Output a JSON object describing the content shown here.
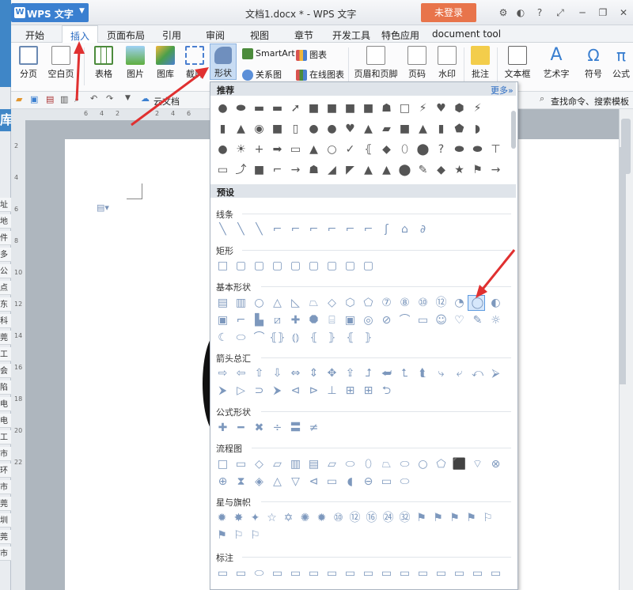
{
  "app": {
    "logo": "WPS 文字",
    "doc_title": "文档1.docx * - WPS 文字",
    "login": "未登录"
  },
  "bg_app": {
    "banner_char": "库",
    "list": [
      "址",
      "地",
      "件",
      "多",
      "公",
      "点",
      "东",
      "科",
      "莞",
      "工",
      "会",
      "陷",
      "电",
      "电",
      "工",
      "市",
      "环",
      "市",
      "莞",
      "圳",
      "莞",
      "市"
    ]
  },
  "menu": [
    "开始",
    "插入",
    "页面布局",
    "引用",
    "审阅",
    "视图",
    "章节",
    "开发工具",
    "特色应用",
    "document tool"
  ],
  "ribbon": {
    "page_break": "分页",
    "blank_page": "空白页",
    "table": "表格",
    "picture": "图片",
    "gallery": "图库",
    "screenshot": "截屏",
    "shape": "形状",
    "smartart": "SmartArt",
    "chart": "图表",
    "relation": "关系图",
    "online_chart": "在线图表",
    "header_footer": "页眉和页脚",
    "page_number": "页码",
    "watermark": "水印",
    "comment": "批注",
    "textbox": "文本框",
    "wordart": "艺术字",
    "symbol": "符号",
    "formula": "公式"
  },
  "quickbar": {
    "cloud": "云文档",
    "search": "查找命令、搜索模板"
  },
  "ruler": [
    "6",
    "4",
    "2",
    "2",
    "4",
    "6"
  ],
  "vruler": [
    "2",
    "4",
    "6",
    "8",
    "10",
    "12",
    "14",
    "16",
    "18",
    "20",
    "22"
  ],
  "panel": {
    "recommend": "推荐",
    "more": "更多",
    "preset": "预设",
    "lines": "线条",
    "rect": "矩形",
    "basic": "基本形状",
    "arrows": "箭头总汇",
    "formula": "公式形状",
    "flowchart": "流程图",
    "stars": "星与旗帜",
    "callout": "标注",
    "rec_rows": [
      [
        "●",
        "⬬",
        "▬",
        "▬",
        "➚",
        "■",
        "■",
        "■",
        "■",
        "☗",
        "□",
        "⚡",
        "♥",
        "⬢",
        "⚡"
      ],
      [
        "▮",
        "▲",
        "◉",
        "■",
        "▯",
        "●",
        "●",
        "♥",
        "▲",
        "▰",
        "■",
        "▲",
        "▮",
        "⬟",
        "◗"
      ],
      [
        "●",
        "☀",
        "+",
        "➡",
        "▭",
        "▲",
        "○",
        "✓",
        "⦃",
        "◆",
        "⬯",
        "⬤",
        "?",
        "⬬",
        "⬬",
        "⊤"
      ],
      [
        "▭",
        "⤴",
        "■",
        "⌐",
        "→",
        "☗",
        "◢",
        "◤",
        "▲",
        "▲",
        "⬤",
        "✎",
        "◆",
        "★",
        "⚑",
        "→"
      ]
    ],
    "line_row": [
      "╲",
      "╲",
      "╲",
      "⌐",
      "⌐",
      "⌐",
      "⌐",
      "⌐",
      "⌐",
      "ʃ",
      "⌂",
      "∂"
    ],
    "rect_row": [
      "□",
      "▢",
      "▢",
      "▢",
      "▢",
      "▢",
      "▢",
      "▢",
      "▢"
    ],
    "basic_rows": [
      [
        "▤",
        "▥",
        "○",
        "△",
        "◺",
        "⏢",
        "◇",
        "⬡",
        "⬠",
        "⑦",
        "⑧",
        "⑩",
        "⑫",
        "◔",
        "◯",
        "◐"
      ],
      [
        "▣",
        "⌐",
        "▙",
        "⧄",
        "✚",
        "⯃",
        "⌸",
        "▣",
        "◎",
        "⊘",
        "⌒",
        "▭",
        "☺",
        "♡",
        "✎",
        "☼"
      ],
      [
        "☾",
        "⬭",
        "⌒",
        "⦃⦄",
        "⦅⦆",
        "⦃",
        "⦄",
        "⦃",
        "⦄"
      ]
    ],
    "arrow_rows": [
      [
        "⇨",
        "⇦",
        "⇧",
        "⇩",
        "⇔",
        "⇕",
        "✥",
        "⇪",
        "⮥",
        "⮨",
        "⮤",
        "⮬",
        "⤷",
        "⤶",
        "⤺",
        "⮚"
      ],
      [
        "⮞",
        "▷",
        "⊃",
        "⮞",
        "⊲",
        "⊳",
        "⊥",
        "⊞",
        "⊞",
        "⮌"
      ]
    ],
    "formula_row": [
      "✚",
      "━",
      "✖",
      "÷",
      "〓",
      "≠"
    ],
    "flow_rows": [
      [
        "□",
        "▭",
        "◇",
        "▱",
        "▥",
        "▤",
        "▱",
        "⬭",
        "⬯",
        "⏢",
        "⬭",
        "○",
        "⬠",
        "⬛",
        "⌔",
        "⊗"
      ],
      [
        "⊕",
        "⧗",
        "◈",
        "△",
        "▽",
        "⊲",
        "▭",
        "◖",
        "⊖",
        "▭",
        "⬭"
      ]
    ],
    "star_rows": [
      [
        "✹",
        "✸",
        "✦",
        "☆",
        "✡",
        "✺",
        "✹",
        "⑩",
        "⑫",
        "⑯",
        "㉔",
        "㉜",
        "⚑",
        "⚑",
        "⚑",
        "⚑",
        "⚐"
      ],
      [
        "⚑",
        "⚐",
        "⚐"
      ]
    ],
    "callout_row": [
      "▭",
      "▭",
      "⬭",
      "▭",
      "▭",
      "▭",
      "▭",
      "▭",
      "▭",
      "▭",
      "▭",
      "▭",
      "▭",
      "▭",
      "▭",
      "▭"
    ]
  },
  "colors": {
    "wps_blue": "#3a7fd0",
    "login_orange": "#e8744b",
    "arrow_red": "#e03030"
  }
}
